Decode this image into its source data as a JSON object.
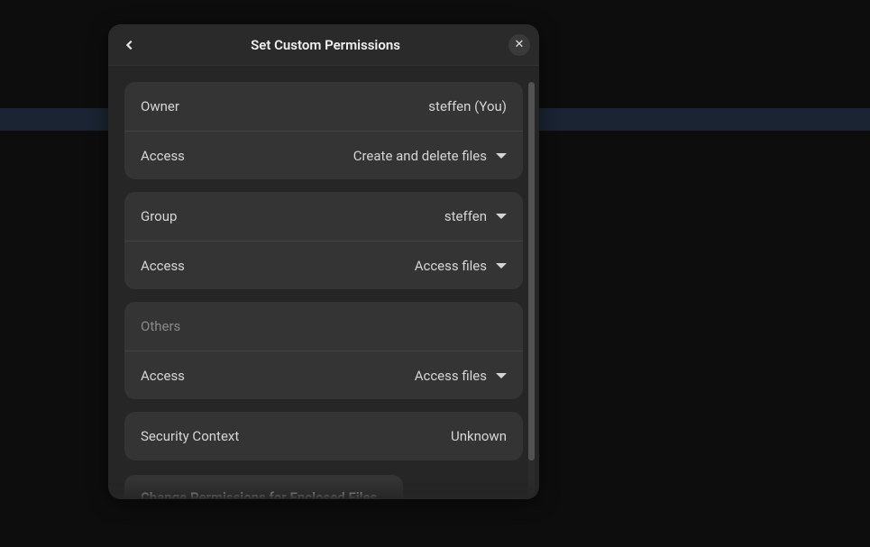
{
  "dialog": {
    "title": "Set Custom Permissions",
    "sections": {
      "owner": {
        "ownerLabel": "Owner",
        "ownerValue": "steffen (You)",
        "accessLabel": "Access",
        "accessValue": "Create and delete files"
      },
      "group": {
        "groupLabel": "Group",
        "groupValue": "steffen",
        "accessLabel": "Access",
        "accessValue": "Access files"
      },
      "others": {
        "othersLabel": "Others",
        "accessLabel": "Access",
        "accessValue": "Access files"
      },
      "security": {
        "label": "Security Context",
        "value": "Unknown"
      }
    },
    "enclosedButton": "Change Permissions for Enclosed Files…"
  }
}
